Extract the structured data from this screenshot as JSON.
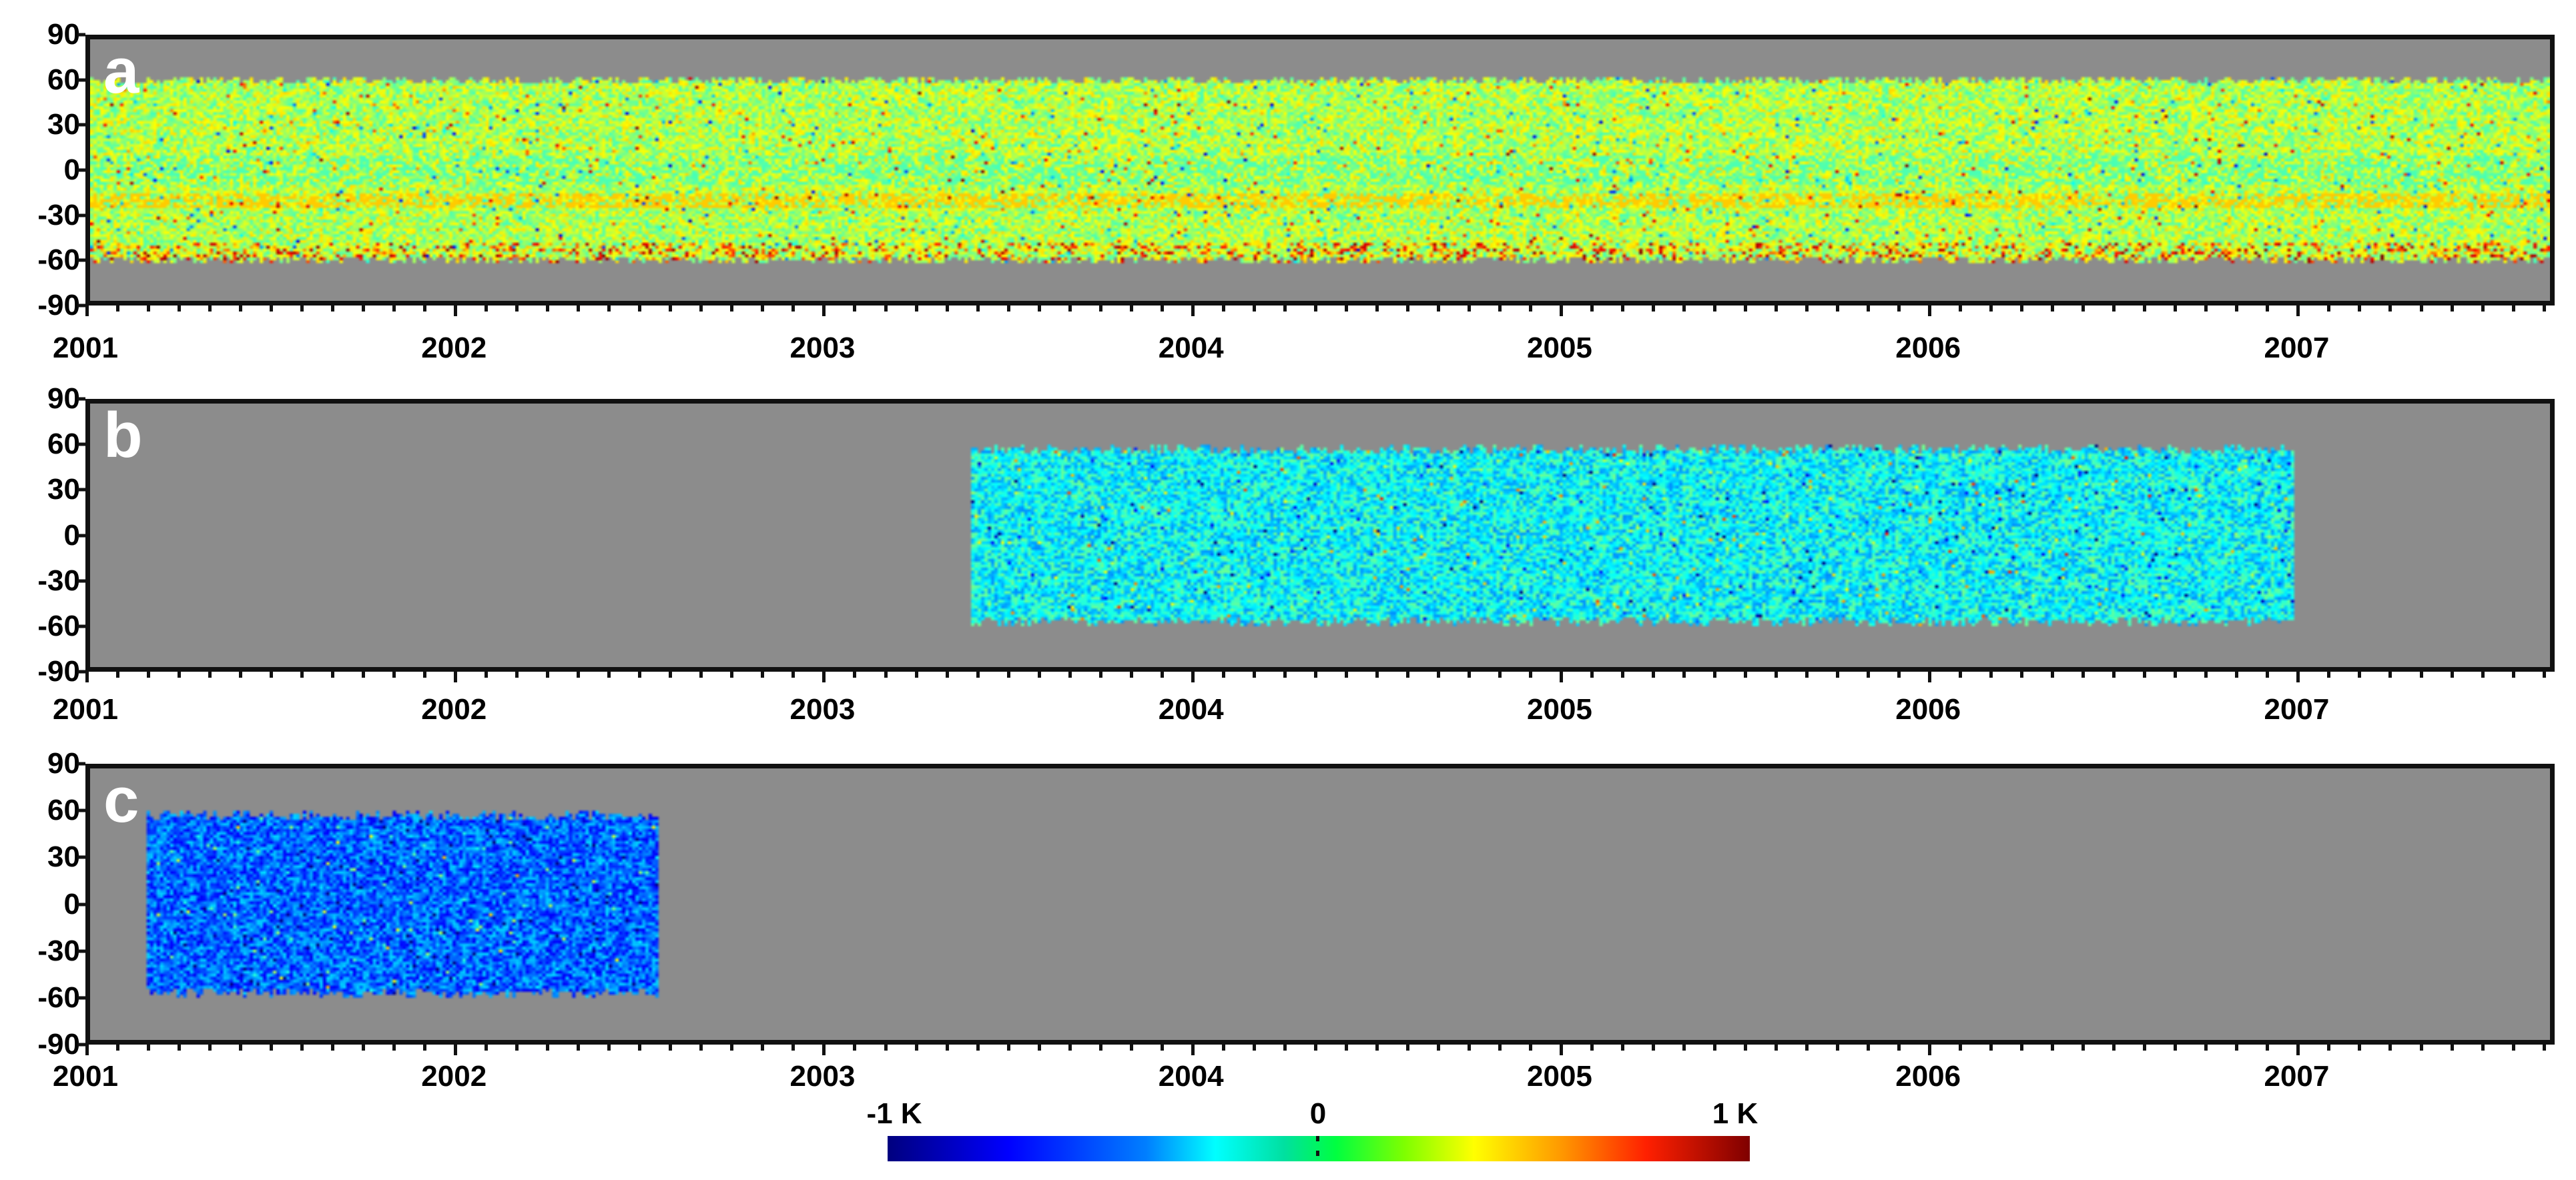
{
  "chart_data": {
    "type": "heatmap",
    "xlabel": "",
    "ylabel": "",
    "xlim": [
      2001,
      2007.7
    ],
    "ylim": [
      -90,
      90
    ],
    "x_tick_labels": [
      "2001",
      "2002",
      "2003",
      "2004",
      "2005",
      "2006",
      "2007"
    ],
    "y_tick_labels": [
      "90",
      "60",
      "30",
      "0",
      "-30",
      "-60",
      "-90"
    ],
    "missing_color": "#8c8c8c",
    "panels": [
      {
        "label": "a",
        "data_x_range": [
          2001.0,
          2007.7
        ],
        "data_lat_range": [
          -65,
          65
        ],
        "typical_anomaly_K": 0.1,
        "notes_anomaly_K": {
          "band_-20": 0.35,
          "band_-60": 0.4
        }
      },
      {
        "label": "b",
        "data_x_range": [
          2003.4,
          2007.0
        ],
        "data_lat_range": [
          -62,
          62
        ],
        "typical_anomaly_K": -0.25
      },
      {
        "label": "c",
        "data_x_range": [
          2001.15,
          2002.55
        ],
        "data_lat_range": [
          -62,
          62
        ],
        "typical_anomaly_K": -0.55
      }
    ],
    "colorbar": {
      "min": -1,
      "max": 1,
      "colormap": "jet",
      "labels": {
        "min": "-1 K",
        "mid": "0",
        "max": "1 K"
      }
    }
  }
}
